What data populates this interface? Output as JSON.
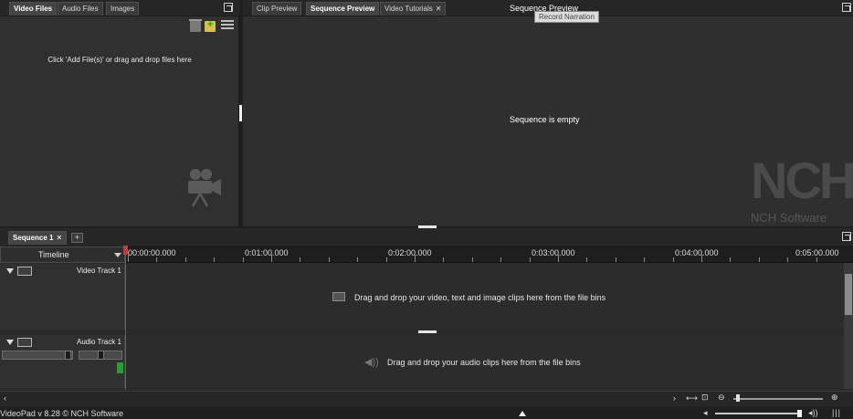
{
  "bins": {
    "tabs": [
      "Video Files",
      "Audio Files",
      "Images"
    ],
    "hint": "Click 'Add File(s)' or drag and drop files here"
  },
  "preview": {
    "tabs": [
      "Clip Preview",
      "Sequence Preview",
      "Video Tutorials"
    ],
    "title": "Sequence Preview",
    "tooltip": "Record Narration",
    "empty_message": "Sequence is empty",
    "logo_text": "NCH",
    "logo_subtext": "NCH Software"
  },
  "timeline": {
    "sequence_tab": "Sequence 1",
    "add_tab": "+",
    "view_select": "Timeline",
    "ticks": [
      "00:00:00.000",
      "0:01:00.000",
      "0:02:00.000",
      "0:03:00.000",
      "0:04:00.000",
      "0:05:00.000"
    ],
    "video_track": {
      "name": "Video Track 1",
      "hint": "Drag and drop your video, text and image clips here from the file bins"
    },
    "audio_track": {
      "name": "Audio Track 1",
      "hint": "Drag and drop your audio clips here from the file bins"
    }
  },
  "status": {
    "text": "VideoPad v 8.28 © NCH Software"
  },
  "colors": {
    "background": "#2f2f2f",
    "playhead": "#d4342e",
    "level_meter": "#2e9a3a"
  }
}
